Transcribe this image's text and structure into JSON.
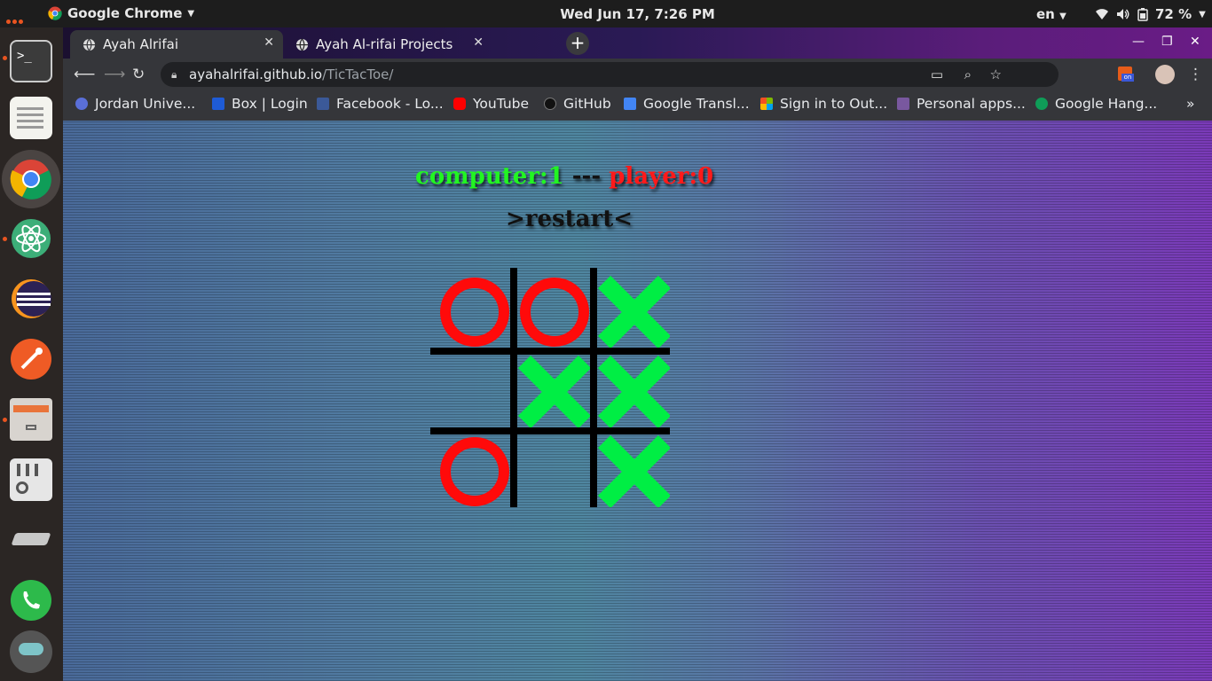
{
  "system": {
    "app_name": "Google Chrome",
    "datetime": "Wed Jun 17,  7:26 PM",
    "language": "en",
    "battery": "72 %"
  },
  "browser": {
    "tabs": [
      {
        "label": "Ayah Alrifai",
        "active": true
      },
      {
        "label": "Ayah Al-rifai Projects",
        "active": false
      }
    ],
    "url_host": "ayahalrifai.github.io",
    "url_path": "/TicTacToe/",
    "bookmarks": [
      {
        "label": "Jordan Unive...",
        "icon": "university-icon",
        "color": "#5a6fd8"
      },
      {
        "label": "Box | Login",
        "icon": "box-icon",
        "color": "#1e5bd6"
      },
      {
        "label": "Facebook - Lo...",
        "icon": "facebook-icon",
        "color": "#3b5998"
      },
      {
        "label": "YouTube",
        "icon": "youtube-icon",
        "color": "#ff0000"
      },
      {
        "label": "GitHub",
        "icon": "github-icon",
        "color": "#111111"
      },
      {
        "label": "Google Transl...",
        "icon": "translate-icon",
        "color": "#4285f4"
      },
      {
        "label": "Sign in to Out...",
        "icon": "microsoft-icon",
        "color": "#f25022"
      },
      {
        "label": "Personal apps...",
        "icon": "heroku-icon",
        "color": "#79589f"
      },
      {
        "label": "Google Hang...",
        "icon": "hangouts-icon",
        "color": "#0f9d58"
      }
    ]
  },
  "game": {
    "computer_label": "computer:1",
    "separator": " --- ",
    "player_label": "player:0",
    "restart_label": ">restart<",
    "board": [
      "O",
      "O",
      "X",
      "",
      "X",
      "X",
      "O",
      "",
      "X"
    ],
    "colors": {
      "x": "#00ee44",
      "o": "#ff0a0a",
      "computer": "#22f522",
      "player": "#ff1a1a"
    }
  },
  "dock": {
    "apps": [
      "terminal-icon",
      "text-editor-icon",
      "chrome-icon",
      "atom-icon",
      "eclipse-icon",
      "postman-icon",
      "files-icon",
      "settings-mixer-icon",
      "system-tools-icon",
      "whatsapp-icon",
      "avatar-icon"
    ]
  }
}
